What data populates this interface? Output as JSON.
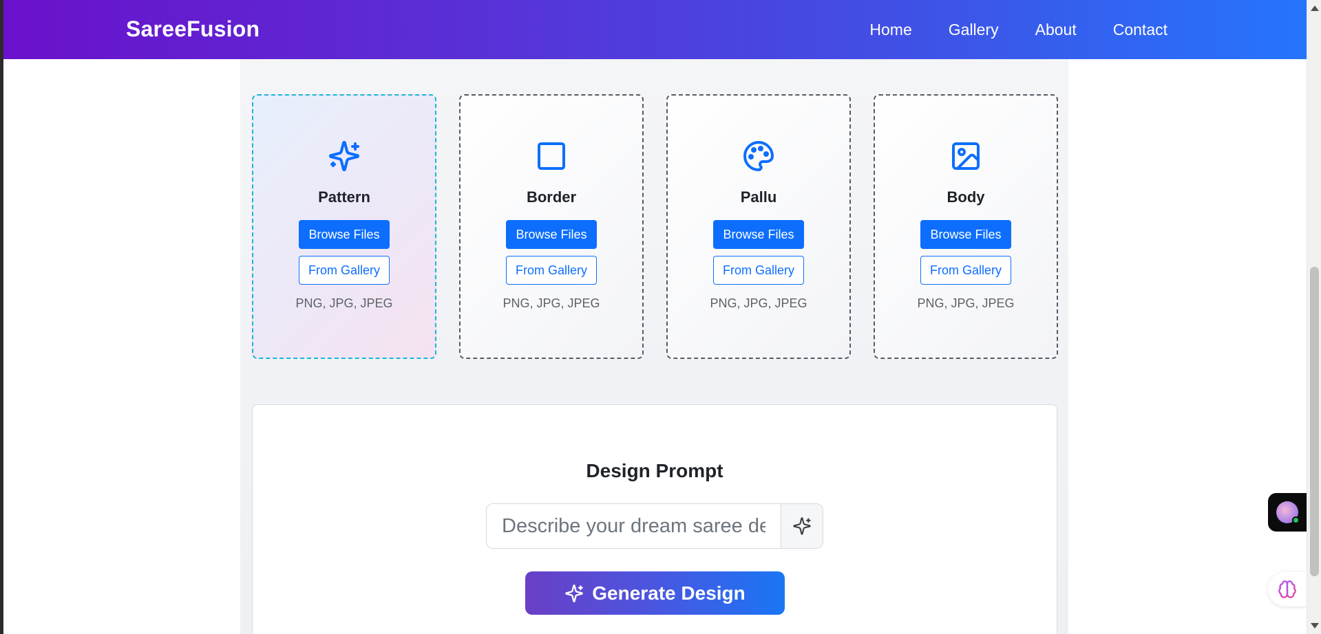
{
  "brand": "SareeFusion",
  "nav": [
    "Home",
    "Gallery",
    "About",
    "Contact"
  ],
  "cards": [
    {
      "title": "Pattern",
      "icon": "sparkles-icon",
      "browse": "Browse Files",
      "gallery": "From Gallery",
      "formats": "PNG, JPG, JPEG"
    },
    {
      "title": "Border",
      "icon": "square-icon",
      "browse": "Browse Files",
      "gallery": "From Gallery",
      "formats": "PNG, JPG, JPEG"
    },
    {
      "title": "Pallu",
      "icon": "palette-icon",
      "browse": "Browse Files",
      "gallery": "From Gallery",
      "formats": "PNG, JPG, JPEG"
    },
    {
      "title": "Body",
      "icon": "image-icon",
      "browse": "Browse Files",
      "gallery": "From Gallery",
      "formats": "PNG, JPG, JPEG"
    }
  ],
  "prompt": {
    "title": "Design Prompt",
    "placeholder": "Describe your dream saree design...",
    "generate": "Generate Design"
  },
  "colors": {
    "accent": "#0d6efd",
    "navbar_start": "#6a11cb",
    "navbar_end": "#2575fc",
    "active_border": "#19b4d8"
  }
}
